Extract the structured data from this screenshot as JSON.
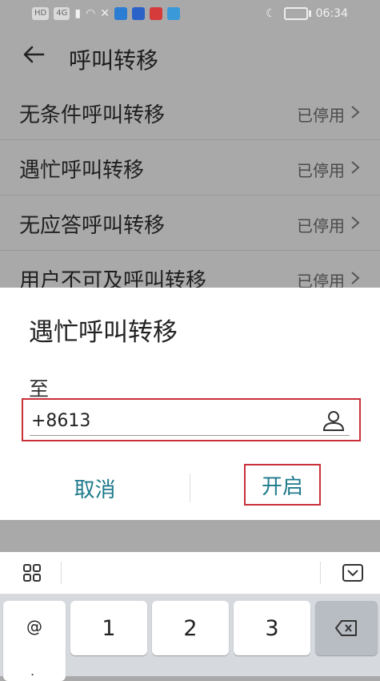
{
  "status_bar": {
    "indicators": [
      "HD",
      "4G"
    ],
    "time": "06:34",
    "icons": [
      "signal-icon",
      "wifi-icon",
      "moon-icon",
      "battery-icon"
    ]
  },
  "header": {
    "title": "呼叫转移"
  },
  "list": {
    "items": [
      {
        "title": "无条件呼叫转移",
        "status": "已停用"
      },
      {
        "title": "遇忙呼叫转移",
        "status": "已停用"
      },
      {
        "title": "无应答呼叫转移",
        "status": "已停用"
      },
      {
        "title": "用户不可及呼叫转移",
        "status": "已停用"
      }
    ]
  },
  "dialog": {
    "title": "遇忙呼叫转移",
    "to_label": "至",
    "phone_value": "+8613",
    "cancel_label": "取消",
    "enable_label": "开启"
  },
  "keyboard": {
    "symbol_key": "@",
    "symbol_key_sub": ".",
    "keys": [
      "1",
      "2",
      "3"
    ]
  },
  "colors": {
    "accent": "#1e7a8c",
    "highlight": "#c8303a",
    "dim_background": "#a9a9a9"
  }
}
